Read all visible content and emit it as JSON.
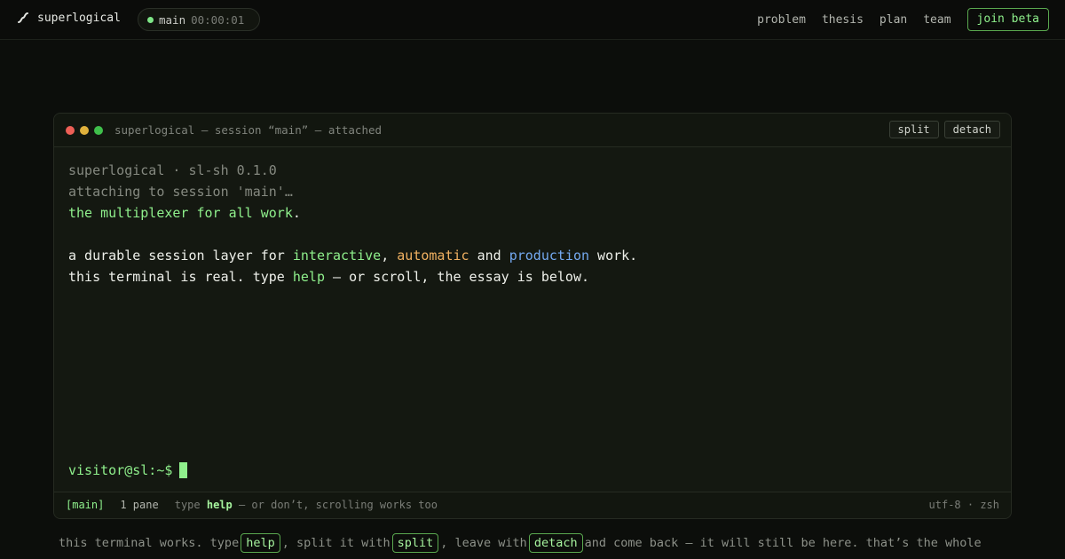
{
  "header": {
    "brand": "superlogical",
    "session_name": "main",
    "session_time": "00:00:01",
    "nav": [
      "problem",
      "thesis",
      "plan",
      "team"
    ],
    "cta": "join beta"
  },
  "terminal": {
    "title": "superlogical — session “main” — attached",
    "buttons": {
      "split": "split",
      "detach": "detach"
    },
    "lines": {
      "l1": "superlogical · sl-sh 0.1.0",
      "l2": "attaching to session 'main'…",
      "l3": "the multiplexer for all work",
      "l3_end": ".",
      "l4_a": "a durable session layer for ",
      "l4_interactive": "interactive",
      "l4_b": ", ",
      "l4_automatic": "automatic",
      "l4_c": " and ",
      "l4_production": "production",
      "l4_d": " work.",
      "l5_a": "this terminal is real. type ",
      "l5_help": "help",
      "l5_b": " — or scroll, the essay is below."
    },
    "prompt": "visitor@sl:~$",
    "status": {
      "tag": "[main]",
      "panes": "1 pane",
      "hint_a": "type ",
      "hint_cmd": "help",
      "hint_b": " — or don’t, scrolling works too",
      "right": "utf-8 · zsh"
    }
  },
  "essay": {
    "a": "this terminal works. type ",
    "k1": "help",
    "b": ", split it with ",
    "k2": "split",
    "c": ", leave with ",
    "k3": "detach",
    "d": " and come back — it will still be here. that’s the whole"
  },
  "colors": {
    "accent_green": "#8ff08c",
    "orange": "#f0b061",
    "blue": "#74a9f0",
    "light_red": "#ed5f56",
    "light_yellow": "#e0b13c",
    "light_green": "#3fbf4b"
  }
}
